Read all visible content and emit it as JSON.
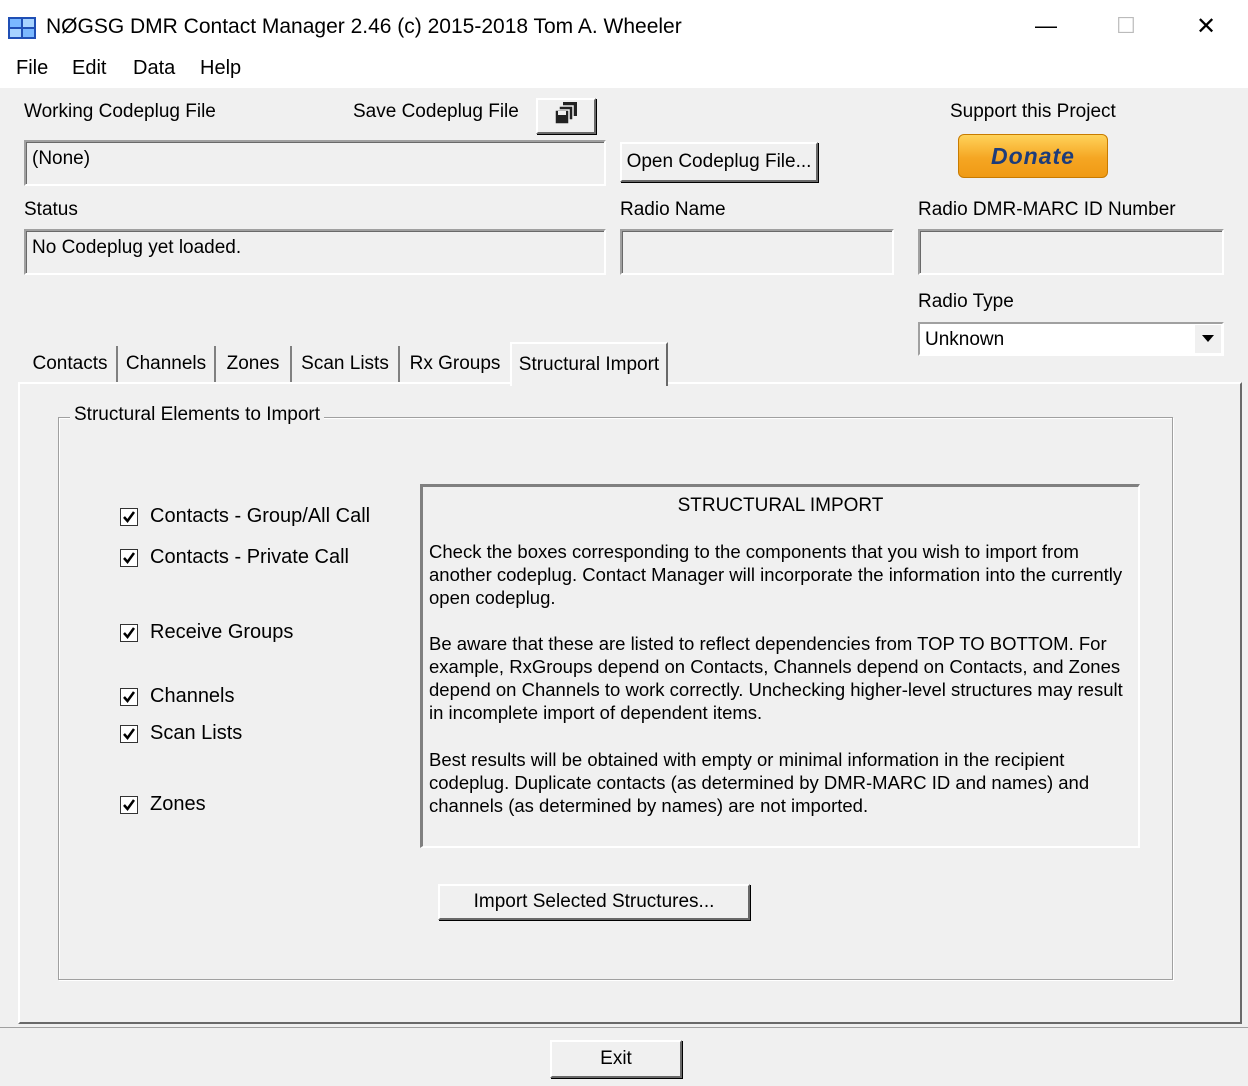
{
  "window": {
    "title": "NØGSG DMR Contact Manager 2.46 (c) 2015-2018 Tom A. Wheeler",
    "minimize_glyph": "—",
    "maximize_glyph": "☐",
    "close_glyph": "✕"
  },
  "menu": [
    "File",
    "Edit",
    "Data",
    "Help"
  ],
  "header": {
    "working_codeplug_label": "Working Codeplug File",
    "working_codeplug_value": "(None)",
    "save_codeplug_label": "Save Codeplug File",
    "open_codeplug_button": "Open Codeplug File...",
    "support_label": "Support this Project",
    "donate_button": "Donate",
    "status_label": "Status",
    "status_value": "No Codeplug yet loaded.",
    "radio_name_label": "Radio Name",
    "radio_name_value": "",
    "radio_id_label": "Radio DMR-MARC ID Number",
    "radio_id_value": "",
    "radio_type_label": "Radio Type",
    "radio_type_value": "Unknown"
  },
  "tabs": [
    "Contacts",
    "Channels",
    "Zones",
    "Scan Lists",
    "Rx Groups",
    "Structural Import"
  ],
  "active_tab": "Structural Import",
  "structural": {
    "group_title": "Structural Elements to Import",
    "checkboxes": [
      {
        "label": "Contacts - Group/All Call",
        "checked": true
      },
      {
        "label": "Contacts - Private Call",
        "checked": true
      },
      {
        "label": "Receive Groups",
        "checked": true
      },
      {
        "label": "Channels",
        "checked": true
      },
      {
        "label": "Scan Lists",
        "checked": true
      },
      {
        "label": "Zones",
        "checked": true
      }
    ],
    "info_title": "STRUCTURAL IMPORT",
    "info_paragraphs": [
      "Check the boxes corresponding to the components that you wish to import from another codeplug. Contact Manager will incorporate the information into the currently open codeplug.",
      "Be aware that these are listed to reflect dependencies from TOP TO BOTTOM. For example, RxGroups depend on Contacts, Channels depend on Contacts, and Zones depend on Channels to work correctly. Unchecking higher-level structures may result in incomplete import of dependent items.",
      "Best results will be obtained with empty or minimal information in the recipient codeplug. Duplicate contacts (as determined by DMR-MARC ID and names) and channels (as determined by names) are not imported."
    ],
    "import_button": "Import Selected Structures..."
  },
  "exit_button": "Exit",
  "colors": {
    "background": "#f0f0f0",
    "donate_gold": "#f5a623",
    "donate_text": "#1d3c7a"
  }
}
